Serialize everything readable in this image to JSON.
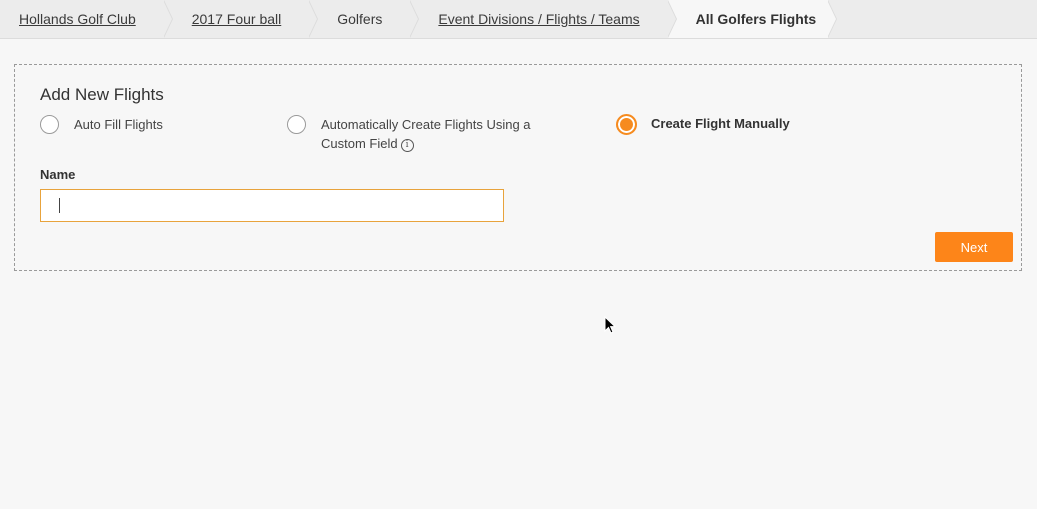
{
  "breadcrumb": {
    "items": [
      {
        "label": "Hollands Golf Club",
        "link": true
      },
      {
        "label": "2017 Four ball",
        "link": true
      },
      {
        "label": "Golfers",
        "link": false
      },
      {
        "label": "Event Divisions / Flights / Teams",
        "link": true
      },
      {
        "label": "All Golfers Flights",
        "link": false,
        "active": true
      }
    ]
  },
  "panel": {
    "title": "Add New Flights",
    "options": [
      {
        "label": "Auto Fill Flights",
        "checked": false
      },
      {
        "label_line1": "Automatically Create Flights Using a",
        "label_line2": "Custom Field",
        "checked": false
      },
      {
        "label": "Create Flight Manually",
        "checked": true
      }
    ],
    "name_label": "Name",
    "name_value": "",
    "next_label": "Next"
  },
  "colors": {
    "accent": "#fd8519",
    "input_border": "#e8a33c",
    "background": "#f7f7f7",
    "breadcrumb_bg": "#ececec"
  },
  "icons": {
    "info": "info-icon",
    "cursor": "mouse-pointer-icon"
  }
}
